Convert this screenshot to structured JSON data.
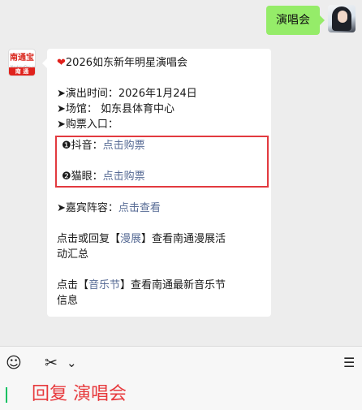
{
  "outgoing": {
    "text": "演唱会"
  },
  "incoming": {
    "avatar_logo": "南通宝",
    "avatar_sub": "NantongBao.com",
    "avatar_bar": "南 通",
    "title_heart": "❤",
    "title": "2026如东新年明星演唱会",
    "time": "➤演出时间：2026年1月24日",
    "venue": "➤场馆： 如东县体育中心",
    "ticket_entry": "➤购票入口：",
    "douyin_label": "❶抖音：",
    "douyin_link": "点击购票",
    "maoyan_label": "❷猫眼：",
    "maoyan_link": "点击购票",
    "guests_label": "➤嘉宾阵容：",
    "guests_link": "点击查看",
    "manzhan_pre": "点击或回复【",
    "manzhan_link": "漫展",
    "manzhan_post": "】查看南通漫展活",
    "manzhan_line2": "动汇总",
    "music_pre": "点击【",
    "music_link": "音乐节",
    "music_post": "】查看南通最新音乐节",
    "music_line2": "信息"
  },
  "toolbar": {
    "emoji_icon": "☺",
    "scissors_icon": "✂",
    "chevron_icon": "⌄",
    "menu_icon": "☰"
  },
  "input": {
    "text": "回复 演唱会"
  }
}
